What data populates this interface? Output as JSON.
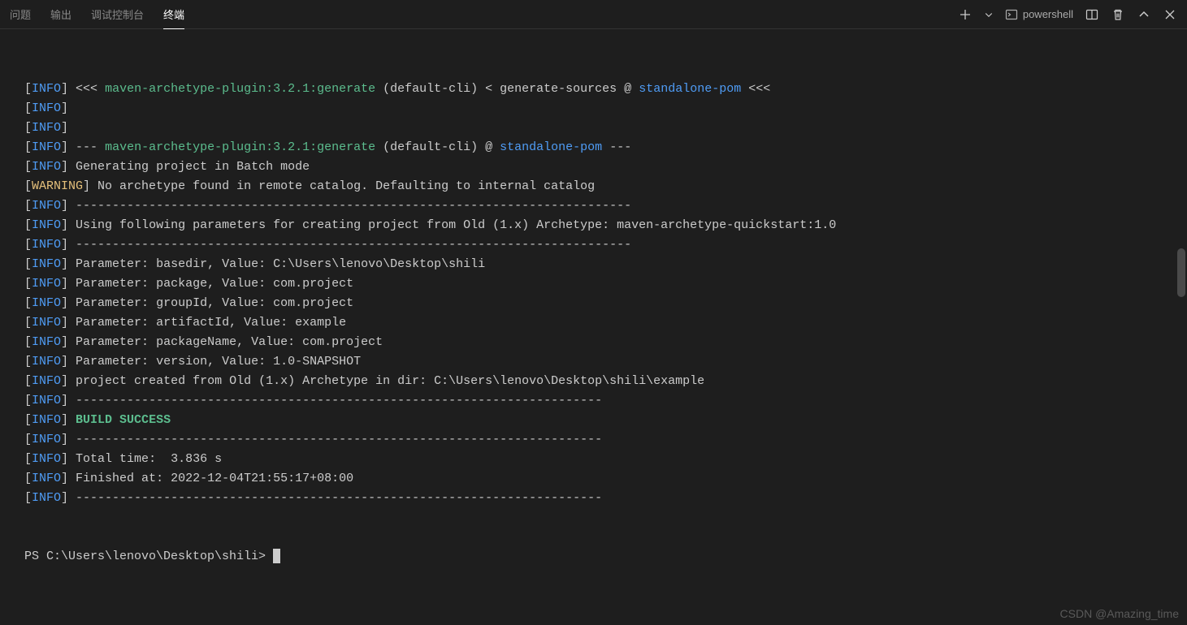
{
  "tabs": {
    "problems": "问题",
    "output": "输出",
    "debug": "调试控制台",
    "terminal": "终端"
  },
  "actions": {
    "shell_label": "powershell"
  },
  "lines": [
    {
      "level": "INFO",
      "segments": [
        {
          "t": " <<< ",
          "c": ""
        },
        {
          "t": "maven-archetype-plugin:3.2.1:generate",
          "c": "green"
        },
        {
          "t": " (default-cli) < generate-sources @ ",
          "c": ""
        },
        {
          "t": "standalone-pom",
          "c": "cyan"
        },
        {
          "t": " <<<",
          "c": ""
        }
      ]
    },
    {
      "level": "INFO",
      "segments": []
    },
    {
      "level": "INFO",
      "segments": []
    },
    {
      "level": "INFO",
      "segments": [
        {
          "t": " --- ",
          "c": ""
        },
        {
          "t": "maven-archetype-plugin:3.2.1:generate",
          "c": "green"
        },
        {
          "t": " (default-cli) @ ",
          "c": ""
        },
        {
          "t": "standalone-pom",
          "c": "cyan"
        },
        {
          "t": " ---",
          "c": ""
        }
      ]
    },
    {
      "level": "INFO",
      "segments": [
        {
          "t": " Generating project in Batch mode",
          "c": ""
        }
      ]
    },
    {
      "level": "WARNING",
      "segments": [
        {
          "t": " No archetype found in remote catalog. Defaulting to internal catalog",
          "c": ""
        }
      ]
    },
    {
      "level": "INFO",
      "segments": [
        {
          "t": " ----------------------------------------------------------------------------",
          "c": ""
        }
      ]
    },
    {
      "level": "INFO",
      "segments": [
        {
          "t": " Using following parameters for creating project from Old (1.x) Archetype: maven-archetype-quickstart:1.0",
          "c": ""
        }
      ]
    },
    {
      "level": "INFO",
      "segments": [
        {
          "t": " ----------------------------------------------------------------------------",
          "c": ""
        }
      ]
    },
    {
      "level": "INFO",
      "segments": [
        {
          "t": " Parameter: basedir, Value: C:\\Users\\lenovo\\Desktop\\shili",
          "c": ""
        }
      ]
    },
    {
      "level": "INFO",
      "segments": [
        {
          "t": " Parameter: package, Value: com.project",
          "c": ""
        }
      ]
    },
    {
      "level": "INFO",
      "segments": [
        {
          "t": " Parameter: groupId, Value: com.project",
          "c": ""
        }
      ]
    },
    {
      "level": "INFO",
      "segments": [
        {
          "t": " Parameter: artifactId, Value: example",
          "c": ""
        }
      ]
    },
    {
      "level": "INFO",
      "segments": [
        {
          "t": " Parameter: packageName, Value: com.project",
          "c": ""
        }
      ]
    },
    {
      "level": "INFO",
      "segments": [
        {
          "t": " Parameter: version, Value: 1.0-SNAPSHOT",
          "c": ""
        }
      ]
    },
    {
      "level": "INFO",
      "segments": [
        {
          "t": " project created from Old (1.x) Archetype in dir: C:\\Users\\lenovo\\Desktop\\shili\\example",
          "c": ""
        }
      ]
    },
    {
      "level": "INFO",
      "segments": [
        {
          "t": " ------------------------------------------------------------------------",
          "c": ""
        }
      ]
    },
    {
      "level": "INFO",
      "segments": [
        {
          "t": " BUILD SUCCESS",
          "c": "build-success"
        }
      ]
    },
    {
      "level": "INFO",
      "segments": [
        {
          "t": " ------------------------------------------------------------------------",
          "c": ""
        }
      ]
    },
    {
      "level": "INFO",
      "segments": [
        {
          "t": " Total time:  3.836 s",
          "c": ""
        }
      ]
    },
    {
      "level": "INFO",
      "segments": [
        {
          "t": " Finished at: 2022-12-04T21:55:17+08:00",
          "c": ""
        }
      ]
    },
    {
      "level": "INFO",
      "segments": [
        {
          "t": " ------------------------------------------------------------------------",
          "c": ""
        }
      ]
    }
  ],
  "prompt": "PS C:\\Users\\lenovo\\Desktop\\shili> ",
  "watermark": "CSDN @Amazing_time"
}
